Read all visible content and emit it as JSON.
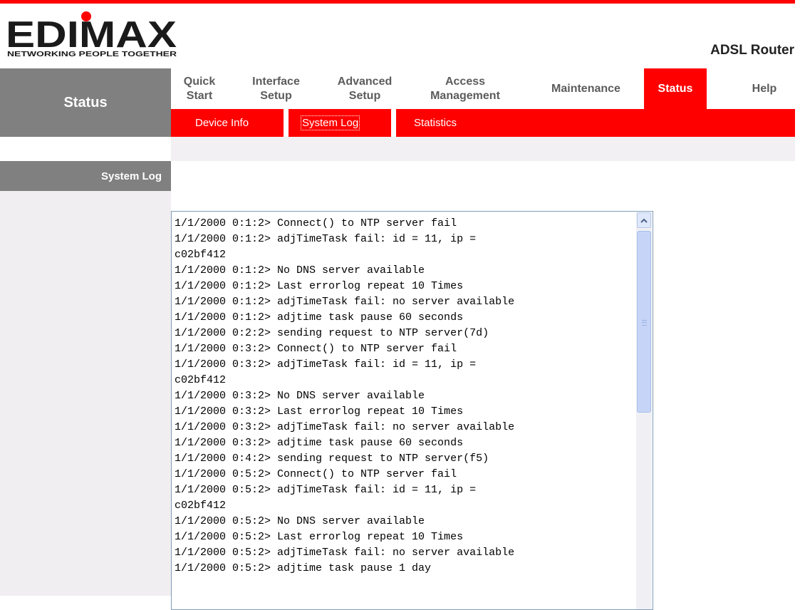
{
  "header": {
    "brand": "EDIMAX",
    "tagline": "NETWORKING PEOPLE TOGETHER",
    "product": "ADSL Router",
    "brand_color": "#ff0000"
  },
  "leftnav": {
    "title": "Status"
  },
  "topnav": {
    "items": [
      {
        "line1": "Quick",
        "line2": "Start"
      },
      {
        "line1": "Interface",
        "line2": "Setup"
      },
      {
        "line1": "Advanced",
        "line2": "Setup"
      },
      {
        "line1": "Access",
        "line2": "Management"
      },
      {
        "line1": "Maintenance",
        "line2": ""
      },
      {
        "line1": "Status",
        "line2": ""
      },
      {
        "line1": "Help",
        "line2": ""
      }
    ],
    "active": "Status"
  },
  "subnav": {
    "items": [
      "Device Info",
      "System Log",
      "Statistics"
    ],
    "selected": "System Log"
  },
  "sidebar": {
    "label": "System Log"
  },
  "log": {
    "text": "1/1/2000 0:1:2> Connect() to NTP server fail\n1/1/2000 0:1:2> adjTimeTask fail: id = 11, ip =\nc02bf412\n1/1/2000 0:1:2> No DNS server available\n1/1/2000 0:1:2> Last errorlog repeat 10 Times\n1/1/2000 0:1:2> adjTimeTask fail: no server available\n1/1/2000 0:1:2> adjtime task pause 60 seconds\n1/1/2000 0:2:2> sending request to NTP server(7d)\n1/1/2000 0:3:2> Connect() to NTP server fail\n1/1/2000 0:3:2> adjTimeTask fail: id = 11, ip =\nc02bf412\n1/1/2000 0:3:2> No DNS server available\n1/1/2000 0:3:2> Last errorlog repeat 10 Times\n1/1/2000 0:3:2> adjTimeTask fail: no server available\n1/1/2000 0:3:2> adjtime task pause 60 seconds\n1/1/2000 0:4:2> sending request to NTP server(f5)\n1/1/2000 0:5:2> Connect() to NTP server fail\n1/1/2000 0:5:2> adjTimeTask fail: id = 11, ip =\nc02bf412\n1/1/2000 0:5:2> No DNS server available\n1/1/2000 0:5:2> Last errorlog repeat 10 Times\n1/1/2000 0:5:2> adjTimeTask fail: no server available\n1/1/2000 0:5:2> adjtime task pause 1 day"
  },
  "icons": {
    "scroll_up": "chevron-up-icon",
    "thumb_grip": "grip-icon"
  }
}
